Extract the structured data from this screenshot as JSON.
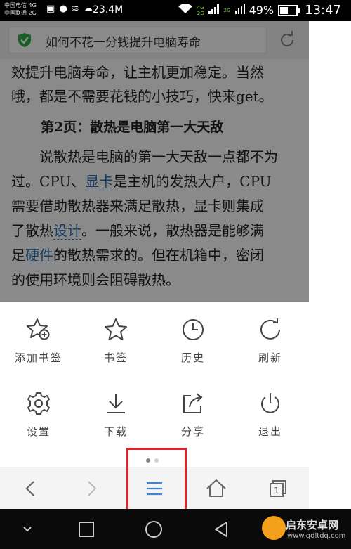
{
  "status_bar": {
    "carrier_1": "中国电信 4G",
    "carrier_2": "中国联通 2G",
    "speed": "23.4M",
    "net_4g": "4G",
    "net_2g": "2G",
    "net_2g_b": "2G",
    "battery": "49%",
    "time": "13:47"
  },
  "address_bar": {
    "title": "如何不花一分钱提升电脑寿命"
  },
  "article": {
    "line1": "效提升电脑寿命，让主机更加稳定。当然",
    "line2": "哦，都是不需要花钱的小技巧，快来get。",
    "heading": "第2页：散热是电脑第一大天敌",
    "p1_a": "说散热是电脑的第一大天敌一点都不为",
    "p2_a": "过。CPU、",
    "kw_1": "显卡",
    "p2_b": "是主机的发热大户，CPU",
    "p3": "需要借助散热器来满足散热，显卡则集成",
    "p4_a": "了散热",
    "kw_2": "设计",
    "p4_b": "。一般来说，散热器是能够满",
    "p5_a": "足",
    "kw_3": "硬件",
    "p5_b": "的散热需求的。但在机箱中，密闭",
    "p6": "的使用环境则会阻碍散热。"
  },
  "menu": {
    "items": [
      {
        "label": "添加书签",
        "icon": "star-plus-icon"
      },
      {
        "label": "书签",
        "icon": "star-icon"
      },
      {
        "label": "历史",
        "icon": "clock-icon"
      },
      {
        "label": "刷新",
        "icon": "refresh-icon"
      },
      {
        "label": "设置",
        "icon": "gear-icon"
      },
      {
        "label": "下载",
        "icon": "download-icon"
      },
      {
        "label": "分享",
        "icon": "share-icon"
      },
      {
        "label": "退出",
        "icon": "power-icon"
      }
    ],
    "page_count": 2,
    "active_page": 1
  },
  "toolbar": {
    "icons": [
      "back-icon",
      "forward-icon",
      "menu-icon",
      "home-icon",
      "tabs-icon"
    ],
    "tab_count": "1"
  },
  "watermark": {
    "name": "启东安卓网",
    "url": "www.qdltdq.com"
  },
  "colors": {
    "accent": "#3a86d0",
    "shield": "#2fae49",
    "highlight": "#d9262a"
  }
}
